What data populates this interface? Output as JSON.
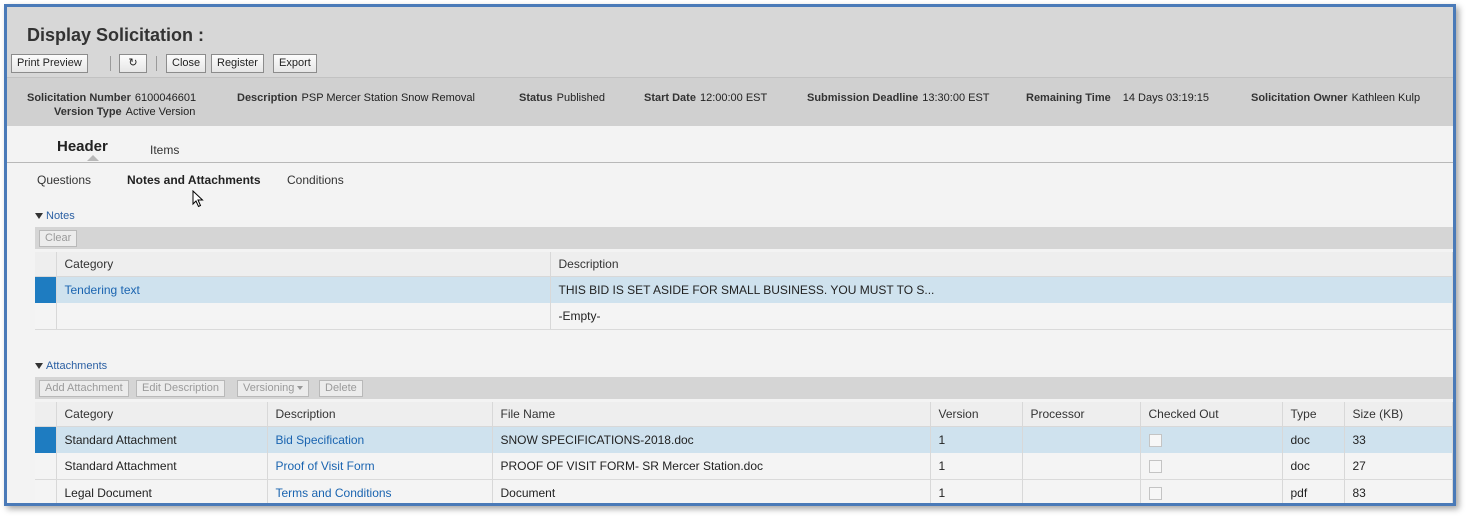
{
  "title": "Display Solicitation :",
  "toolbar": {
    "print_preview": "Print Preview",
    "refresh_icon": "refresh-icon",
    "close": "Close",
    "register": "Register",
    "export": "Export"
  },
  "info": {
    "solicitation_number_label": "Solicitation Number",
    "solicitation_number": "6100046601",
    "version_type_label": "Version Type",
    "version_type": "Active Version",
    "description_label": "Description",
    "description": "PSP Mercer Station Snow Removal",
    "status_label": "Status",
    "status": "Published",
    "start_date_label": "Start Date",
    "start_date": "12:00:00 EST",
    "submission_deadline_label": "Submission Deadline",
    "submission_deadline": "13:30:00 EST",
    "remaining_time_label": "Remaining Time",
    "remaining_time": "14 Days 03:19:15",
    "owner_label": "Solicitation Owner",
    "owner": "Kathleen Kulp"
  },
  "main_tabs": [
    "Header",
    "Items"
  ],
  "sub_tabs": [
    "Questions",
    "Notes and Attachments",
    "Conditions"
  ],
  "notes": {
    "section_label": "Notes",
    "clear_button": "Clear",
    "columns": [
      "Category",
      "Description"
    ],
    "rows": [
      {
        "category": "Tendering text",
        "description": "THIS BID IS SET ASIDE FOR SMALL BUSINESS.  YOU MUST TO S..."
      },
      {
        "category": "",
        "description": "-Empty-"
      }
    ]
  },
  "attachments": {
    "section_label": "Attachments",
    "buttons": {
      "add": "Add Attachment",
      "edit": "Edit Description",
      "versioning": "Versioning",
      "delete": "Delete"
    },
    "columns": [
      "Category",
      "Description",
      "File Name",
      "Version",
      "Processor",
      "Checked Out",
      "Type",
      "Size (KB)"
    ],
    "rows": [
      {
        "category": "Standard Attachment",
        "description": "Bid Specification",
        "file_name": "SNOW SPECIFICATIONS-2018.doc",
        "version": "1",
        "processor": "",
        "type": "doc",
        "size": "33"
      },
      {
        "category": "Standard Attachment",
        "description": "Proof of Visit Form",
        "file_name": "PROOF OF VISIT FORM- SR Mercer Station.doc",
        "version": "1",
        "processor": "",
        "type": "doc",
        "size": "27"
      },
      {
        "category": "Legal Document",
        "description": "Terms and Conditions",
        "file_name": "Document",
        "version": "1",
        "processor": "",
        "type": "pdf",
        "size": "83"
      }
    ]
  },
  "colors": {
    "frame_border": "#4a7ab8",
    "link": "#1a64b0",
    "selection": "#1e7cc1"
  }
}
